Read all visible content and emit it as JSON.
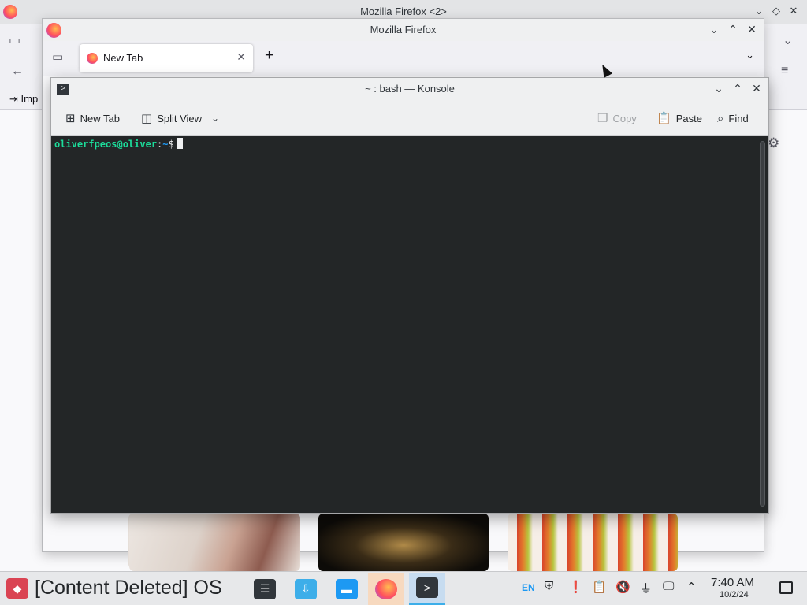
{
  "firefox_back": {
    "title": "Mozilla Firefox <2>",
    "controls": [
      "⌄",
      "◇",
      "✕"
    ],
    "bookmark_label": "Imp",
    "icons": [
      "firefox-logo",
      "list-all-tabs-icon",
      "back-arrow-icon",
      "menu-icon",
      "settings-gear-icon"
    ]
  },
  "firefox_front": {
    "title": "Mozilla Firefox",
    "controls": {
      "minimize": "⌄",
      "maximize": "⌃",
      "close": "✕"
    },
    "tab": {
      "label": "New Tab",
      "close": "✕"
    },
    "new_tab_symbol": "+",
    "tab_list_symbol": "⌄"
  },
  "konsole": {
    "title": "~ : bash — Konsole",
    "controls": {
      "minimize": "⌄",
      "maximize": "⌃",
      "close": "✕"
    },
    "toolbar": {
      "new_tab": "New Tab",
      "split_view": "Split View",
      "copy": "Copy",
      "paste": "Paste",
      "find": "Find"
    },
    "terminal": {
      "user_host": "oliverfpeos@oliver",
      "separator": ":",
      "path": "~",
      "dollar": "$"
    }
  },
  "taskbar": {
    "launcher_label": "[Content Deleted] OS",
    "tasks": [
      "system-settings",
      "discover",
      "dolphin-files",
      "firefox",
      "konsole"
    ],
    "tray": {
      "language": "EN",
      "icons": [
        "shield-icon",
        "clipboard-alert-icon",
        "clipboard-icon",
        "volume-muted-icon",
        "usb-icon",
        "network-icon",
        "expand-tray-icon"
      ]
    },
    "clock": {
      "time": "7:40 AM",
      "date": "10/2/24"
    }
  },
  "colors": {
    "prompt_user": "#1cdc9a",
    "prompt_path": "#1d99f3",
    "terminal_bg": "#232627",
    "accent": "#3daee9",
    "launcher_red": "#da4453"
  }
}
